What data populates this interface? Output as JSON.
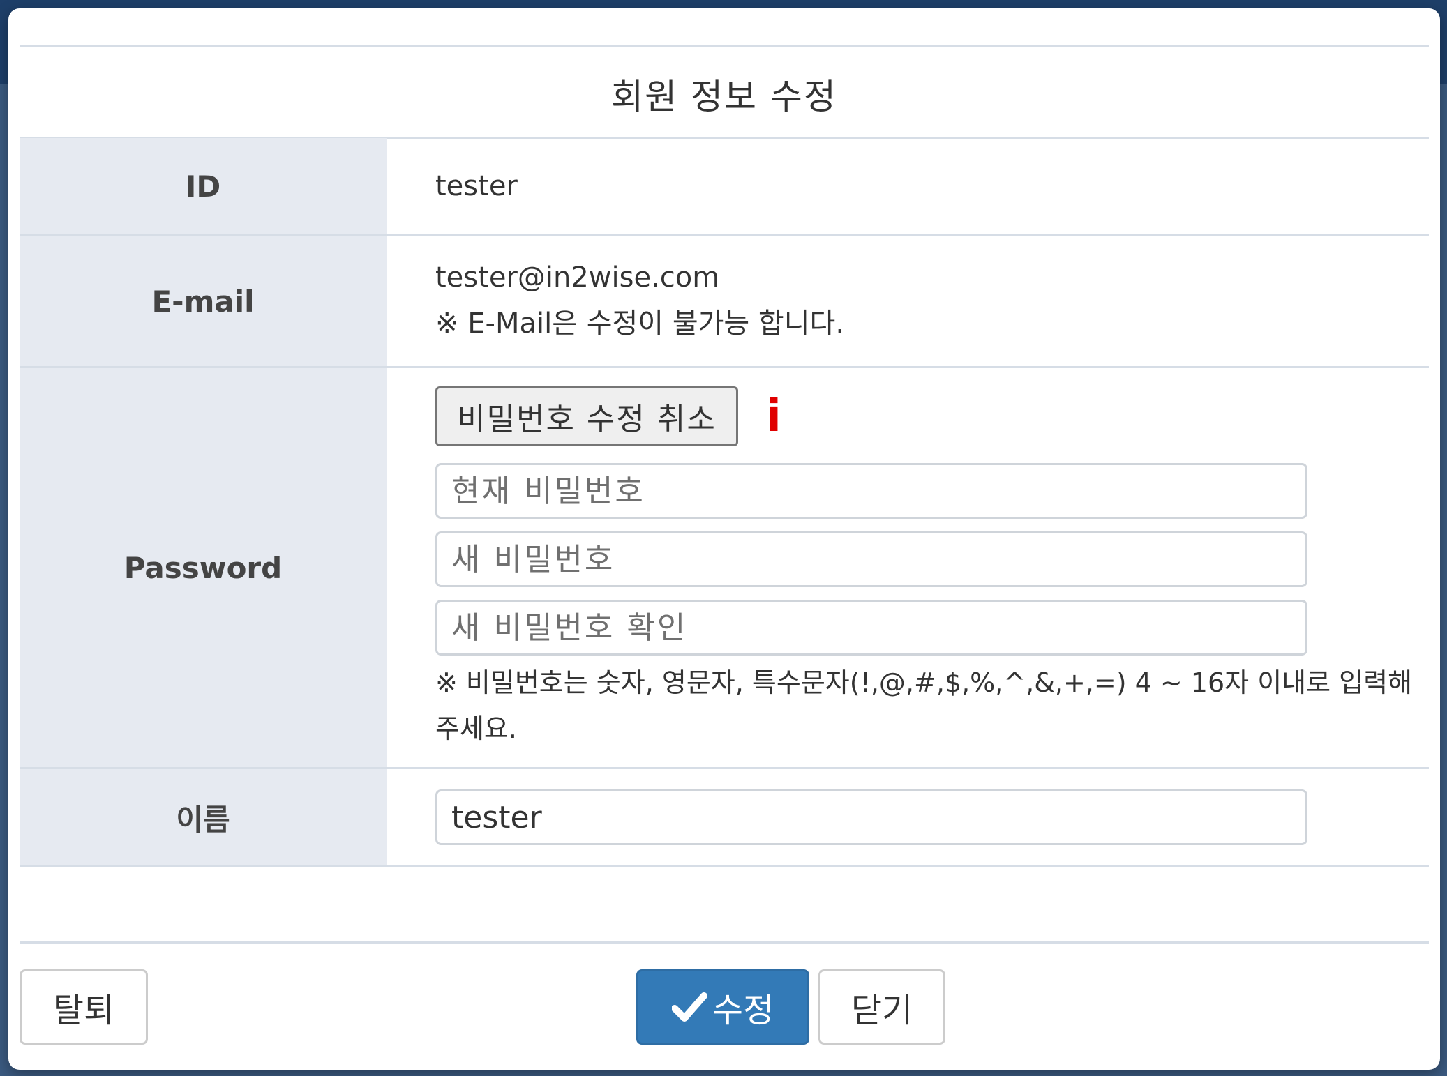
{
  "modal": {
    "title": "회원 정보 수정"
  },
  "form": {
    "id": {
      "label": "ID",
      "value": "tester"
    },
    "email": {
      "label": "E-mail",
      "value": "tester@in2wise.com",
      "note": "※ E-Mail은 수정이 불가능 합니다."
    },
    "password": {
      "label": "Password",
      "cancel_button": "비밀번호 수정 취소",
      "info_mark": "i",
      "current_placeholder": "현재 비밀번호",
      "new_placeholder": "새 비밀번호",
      "confirm_placeholder": "새 비밀번호 확인",
      "note": "※ 비밀번호는 숫자, 영문자, 특수문자(!,@,#,$,%,^,&,+,=) 4 ~ 16자 이내로 입력해 주세요."
    },
    "name": {
      "label": "이름",
      "value": "tester"
    }
  },
  "footer": {
    "withdraw_label": "탈퇴",
    "submit_label": "수정",
    "close_label": "닫기"
  },
  "colors": {
    "primary": "#337ab7",
    "label_bg": "#e6eaf1",
    "info_mark": "#e00000"
  }
}
